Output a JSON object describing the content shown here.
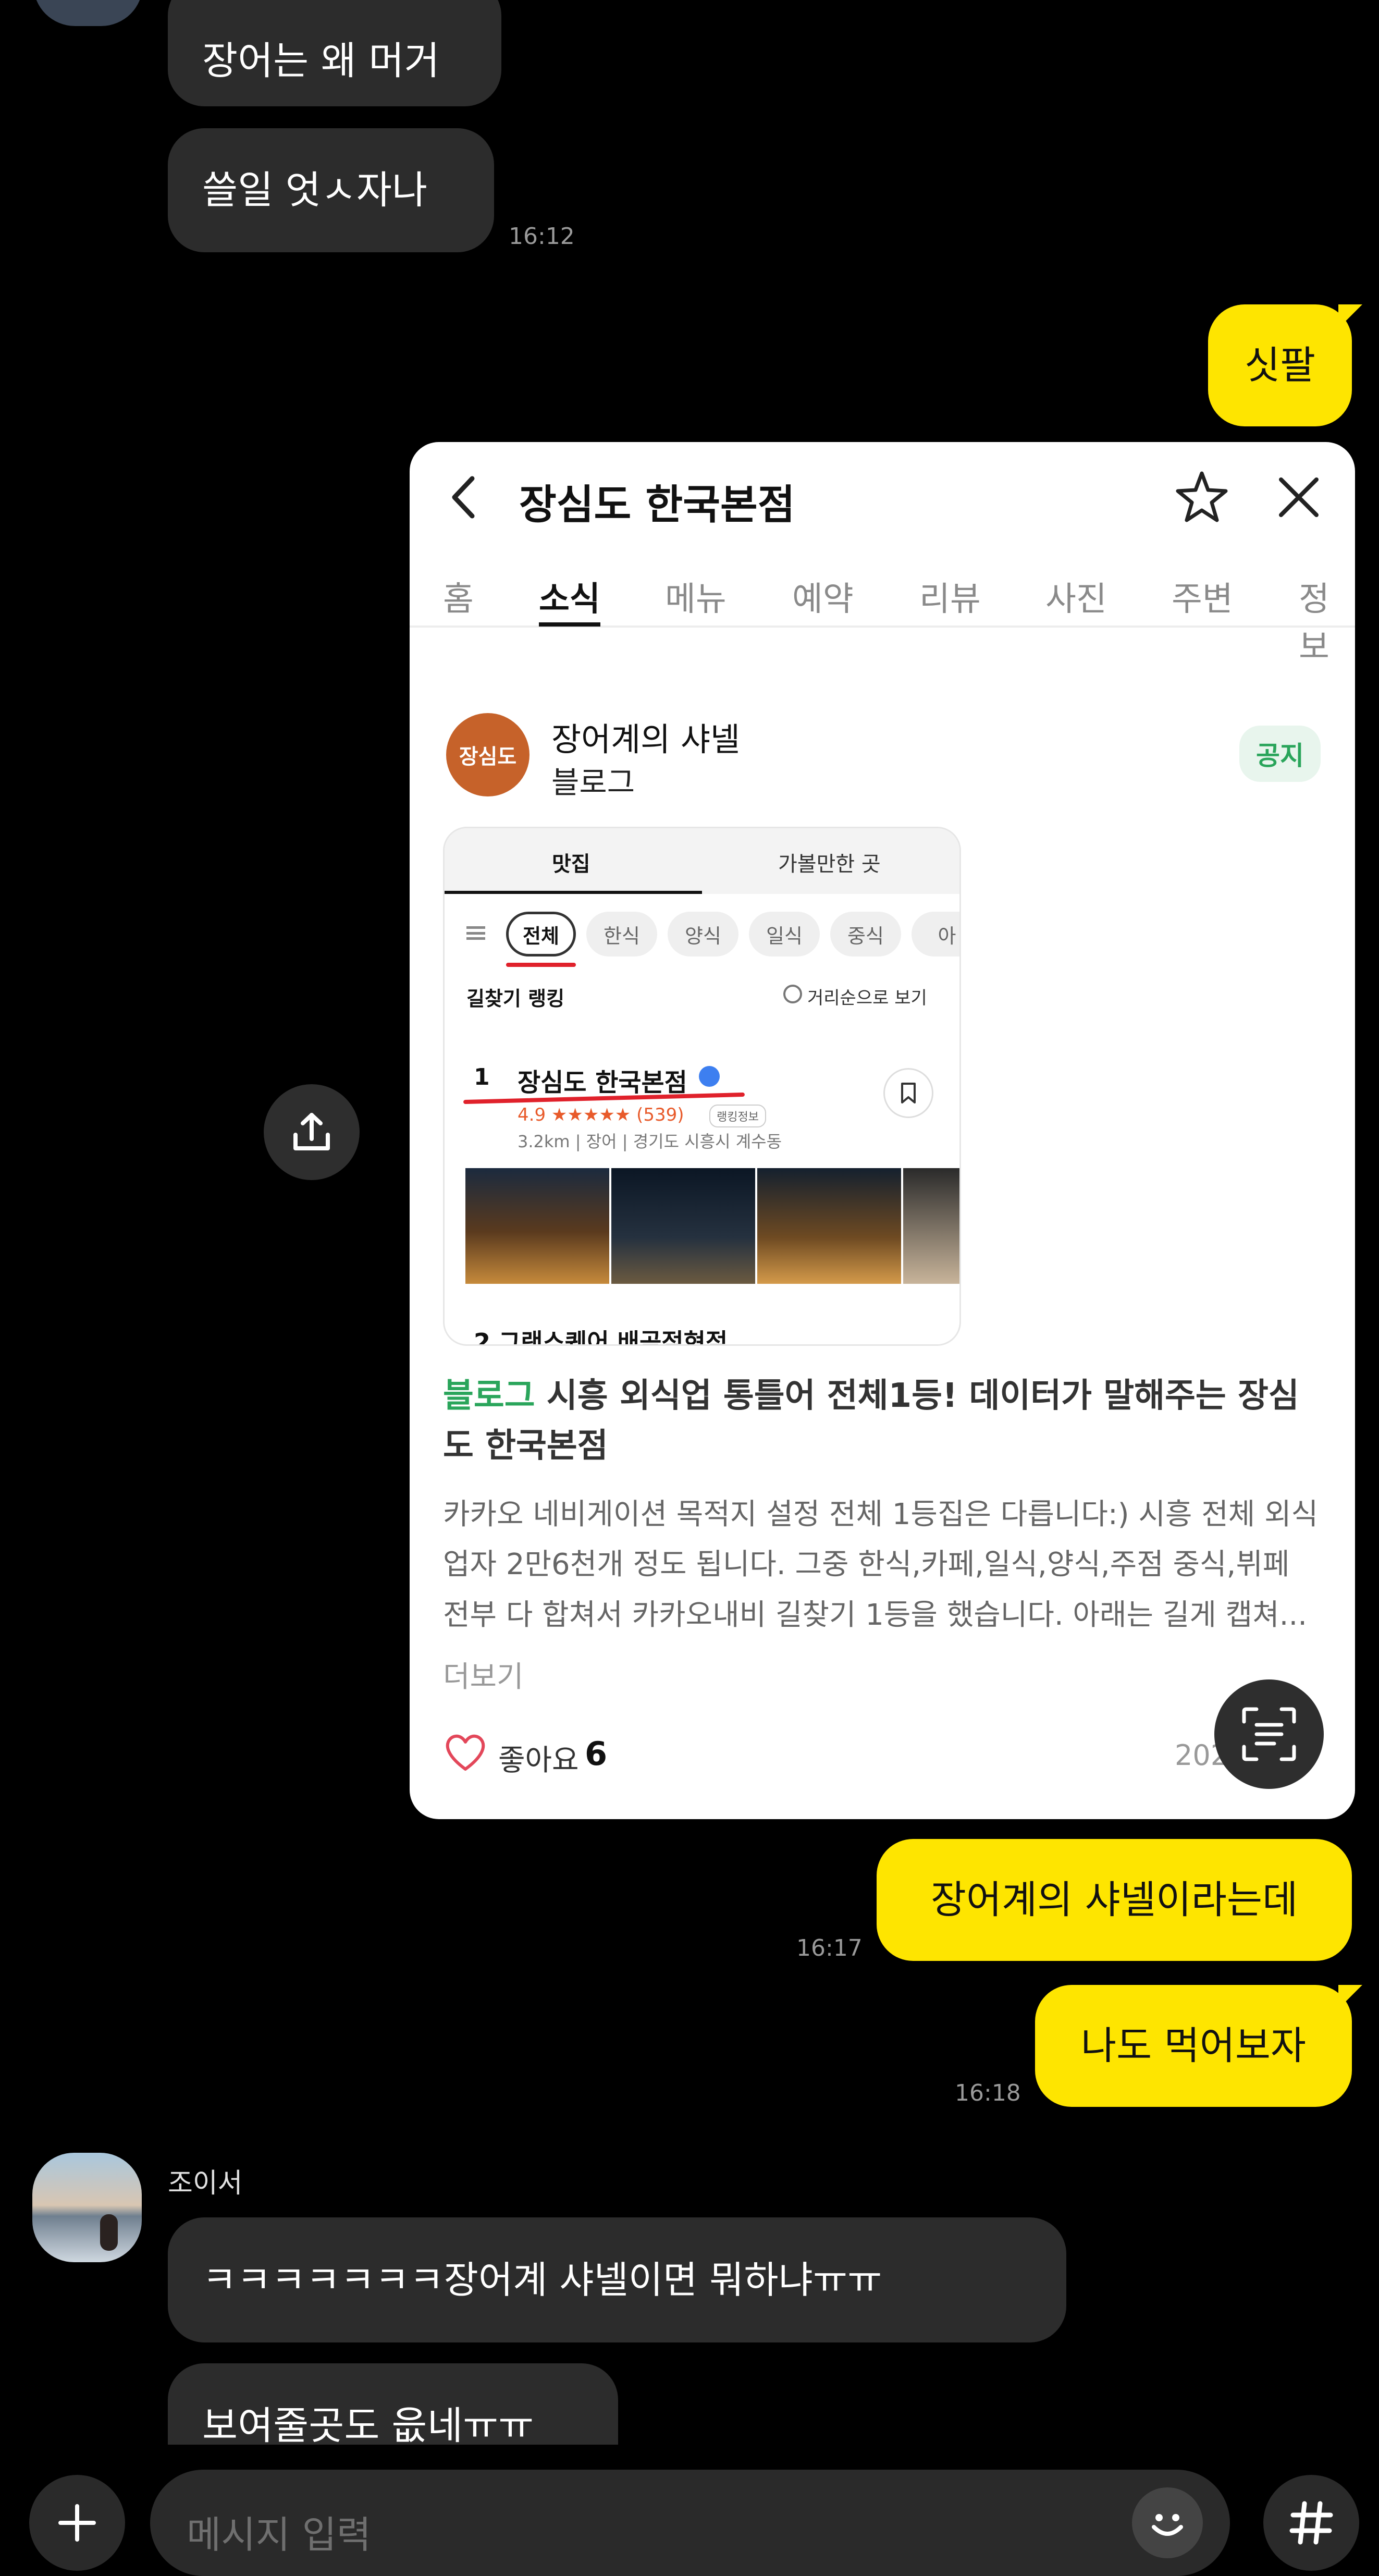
{
  "messages_top": {
    "bubble1": "장어는 왜 머거",
    "bubble2": "쓸일 엇ㅅ자나",
    "time1": "16:12",
    "out1": "싯팔"
  },
  "card": {
    "title": "장심도 한국본점",
    "tabs": [
      "홈",
      "소식",
      "메뉴",
      "예약",
      "리뷰",
      "사진",
      "주변",
      "정보"
    ],
    "active_tab": "소식",
    "author_name": "장어계의 샤넬",
    "author_type": "블로그",
    "logo_text": "장심도",
    "badge": "공지",
    "inner": {
      "tab_left": "맛집",
      "tab_right": "가볼만한 곳",
      "chips": [
        "전체",
        "한식",
        "양식",
        "일식",
        "중식",
        "아"
      ],
      "ranking_label": "길찾기 랭킹",
      "sort_label": "거리순으로 보기",
      "rank1_num": "1",
      "rank1_name": "장심도 한국본점",
      "rank1_rating": "4.9 ★★★★★ (539)",
      "rank1_tag": "랭킹정보",
      "rank1_meta": "3.2km | 장어 | 경기도 시흥시 계수동",
      "rank2_partial": "2  그랜스퀘어 배곧점현점"
    },
    "headline_tag": "블로그",
    "headline": "시흥 외식업 통틀어 전체1등! 데이터가 말해주는 장심도 한국본점",
    "body": "카카오 네비게이션 목적지 설정 전체 1등집은 다릅니다:) 시흥 전체 외식업자 2만6천개 정도 됩니다. 그중 한식,카페,일식,양식,주점 중식,뷔페 전부 다 합쳐서 카카오내비 길찾기 1등을 했습니다. 아래는 길게 캡쳐...",
    "more": "더보기",
    "like_label": "좋아요",
    "like_count": "6",
    "date_partial": "202"
  },
  "messages_bottom": {
    "out2": "장어계의 샤넬이라는데",
    "time2": "16:17",
    "out3": "나도 먹어보자",
    "time3": "16:18",
    "sender": "조이서",
    "in3": "ㅋㅋㅋㅋㅋㅋㅋ장어계 샤넬이면 뭐하냐ㅠㅠ",
    "in4": "보여줄곳도 읎네ㅠㅠ"
  },
  "input": {
    "placeholder": "메시지 입력"
  },
  "colors": {
    "background": "#000000",
    "incoming_bubble": "#2c2c2c",
    "outgoing_bubble": "#fee500",
    "brand_green": "#2aa55b"
  },
  "icons": [
    "upload-share-icon",
    "text-scan-icon",
    "back-arrow-icon",
    "star-icon",
    "close-icon",
    "heart-icon",
    "plus-icon",
    "emoji-icon",
    "hashtag-icon"
  ]
}
